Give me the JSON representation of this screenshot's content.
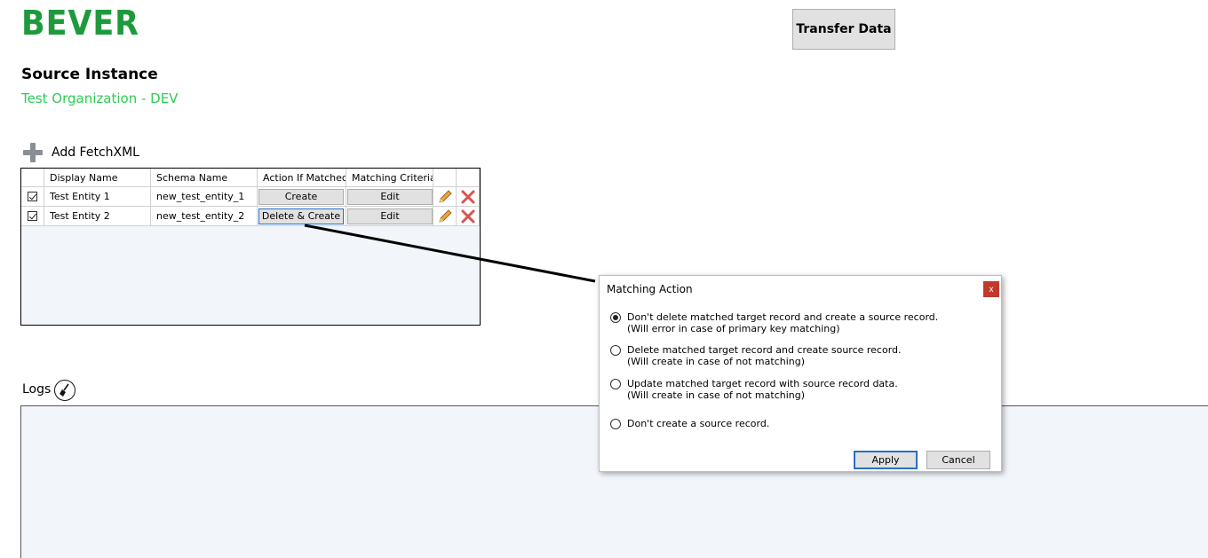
{
  "app": {
    "logo": "BEVER"
  },
  "toolbar": {
    "transfer_label": "Transfer Data"
  },
  "source": {
    "heading": "Source Instance",
    "organization": "Test Organization - DEV",
    "organization_color": "#2ecc55"
  },
  "fetch": {
    "add_label": "Add FetchXML"
  },
  "grid": {
    "columns": [
      "",
      "Display Name",
      "Schema Name",
      "Action If Matched",
      "Matching Criteria",
      "",
      ""
    ],
    "rows": [
      {
        "checked": true,
        "display_name": "Test Entity 1",
        "schema_name": "new_test_entity_1",
        "action": "Create",
        "criteria": "Edit",
        "edit_icon": "pencil-icon",
        "delete_icon": "x-icon"
      },
      {
        "checked": true,
        "display_name": "Test Entity 2",
        "schema_name": "new_test_entity_2",
        "action": "Delete & Create",
        "criteria": "Edit",
        "edit_icon": "pencil-icon",
        "delete_icon": "x-icon"
      }
    ]
  },
  "logs": {
    "label": "Logs",
    "clear_icon": "broom-icon"
  },
  "dialog": {
    "title": "Matching Action",
    "close_label": "x",
    "options": [
      {
        "line1": "Don't delete matched target record and create a source record.",
        "line2": "(Will error in case of primary key matching)",
        "selected": true
      },
      {
        "line1": "Delete matched target record and create source record.",
        "line2": "(Will create in case of not matching)",
        "selected": false
      },
      {
        "line1": "Update matched target record with source record data.",
        "line2": "(Will create in case of not matching)",
        "selected": false
      },
      {
        "line1": "Don't create a source record.",
        "line2": "",
        "selected": false
      }
    ],
    "apply_label": "Apply",
    "cancel_label": "Cancel"
  },
  "colors": {
    "brand": "#1e9a3c",
    "accent": "#2a6fc4",
    "close": "#c0392b"
  }
}
